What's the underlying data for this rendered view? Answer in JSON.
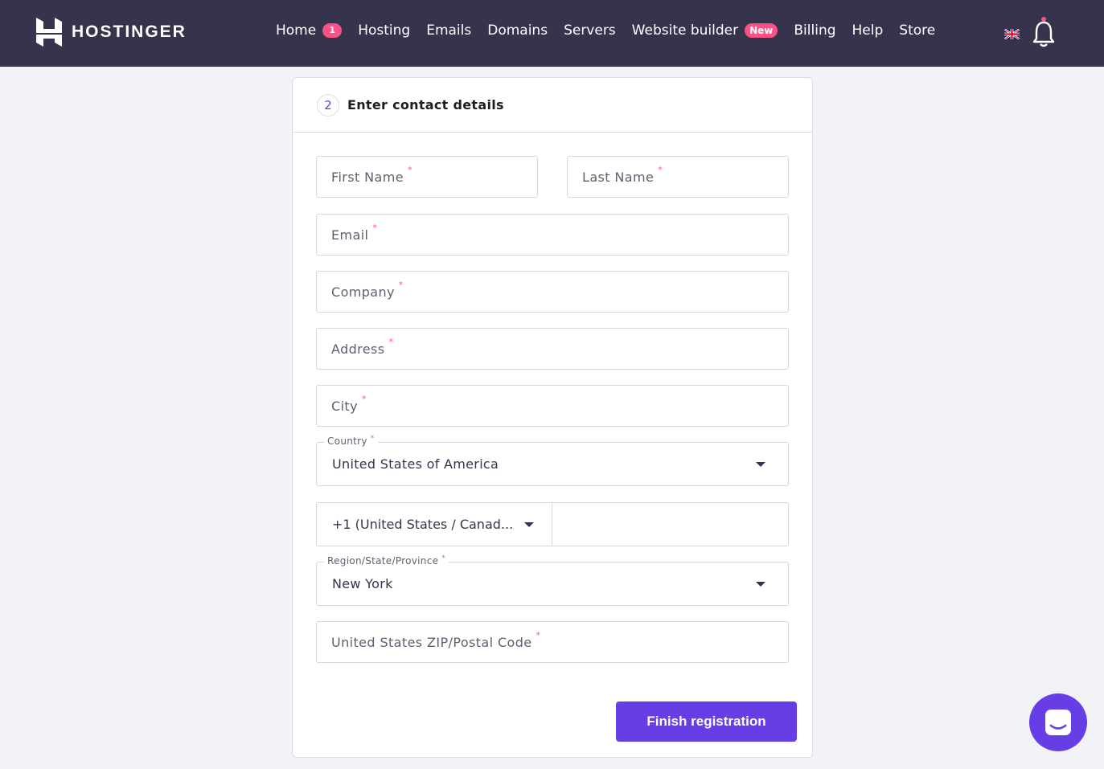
{
  "brand": {
    "name": "HOSTINGER"
  },
  "nav": {
    "items": [
      {
        "label": "Home",
        "badge": "1"
      },
      {
        "label": "Hosting"
      },
      {
        "label": "Emails"
      },
      {
        "label": "Domains"
      },
      {
        "label": "Servers"
      },
      {
        "label": "Website builder",
        "badge": "New"
      },
      {
        "label": "Billing"
      },
      {
        "label": "Help"
      },
      {
        "label": "Store"
      }
    ],
    "language_icon": "uk-flag-icon",
    "notification_icon": "bell-icon"
  },
  "form": {
    "step_number": "2",
    "step_title": "Enter contact details",
    "fields": {
      "first_name": "First Name",
      "last_name": "Last Name",
      "email": "Email",
      "company": "Company",
      "address": "Address",
      "city": "City",
      "zip": "United States ZIP/Postal Code"
    },
    "required_mark": "*",
    "country": {
      "label": "Country",
      "value": "United States of America"
    },
    "phone_code": {
      "value": "+1 (United States / Canad..."
    },
    "phone_number": {
      "value": ""
    },
    "region": {
      "label": "Region/State/Province",
      "value": "New York"
    },
    "submit_label": "Finish registration"
  },
  "colors": {
    "topbar": "#36344d",
    "accent": "#673de6",
    "badge": "#fc5185"
  },
  "chat": {
    "icon": "chat-icon"
  }
}
